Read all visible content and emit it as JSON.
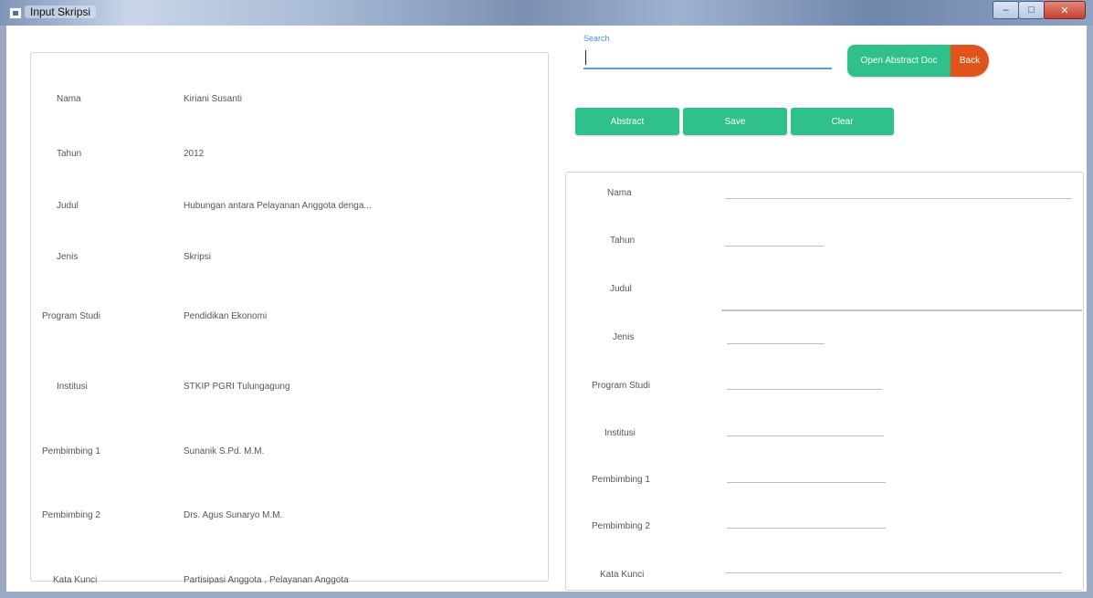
{
  "window": {
    "title": "Input Skripsi",
    "controls": {
      "minimize": "–",
      "maximize": "□",
      "close": "✕"
    }
  },
  "left_panel": {
    "rows": [
      {
        "label": "Nama",
        "value": "Kiriani Susanti"
      },
      {
        "label": "Tahun",
        "value": "2012"
      },
      {
        "label": "Judul",
        "value": "Hubungan antara Pelayanan Anggota denga..."
      },
      {
        "label": "Jenis",
        "value": "Skripsi"
      },
      {
        "label": "Program Studi",
        "value": "Pendidikan Ekonomi"
      },
      {
        "label": "Institusi",
        "value": "STKIP PGRI Tulungagung"
      },
      {
        "label": "Pembimbing 1",
        "value": "Sunanik S.Pd. M.M."
      },
      {
        "label": "Pembimbing 2",
        "value": "Drs. Agus Sunaryo M.M."
      },
      {
        "label": "Kata Kunci",
        "value": "Partisipasi Anggota , Pelayanan Anggota"
      }
    ]
  },
  "search": {
    "label": "Search",
    "value": ""
  },
  "buttons": {
    "open_abstract": "Open Abstract Doc",
    "back": "Back",
    "extract": "Abstract",
    "save": "Save",
    "clear": "Clear"
  },
  "right_panel": {
    "labels": [
      "Nama",
      "Tahun",
      "Judul",
      "Jenis",
      "Program Studi",
      "Institusi",
      "Pembimbing 1",
      "Pembimbing 2",
      "Kata Kunci"
    ]
  },
  "colors": {
    "accent_green": "#2fc08b",
    "back_orange": "#e0541c",
    "search_underline": "#5c9fd8"
  }
}
